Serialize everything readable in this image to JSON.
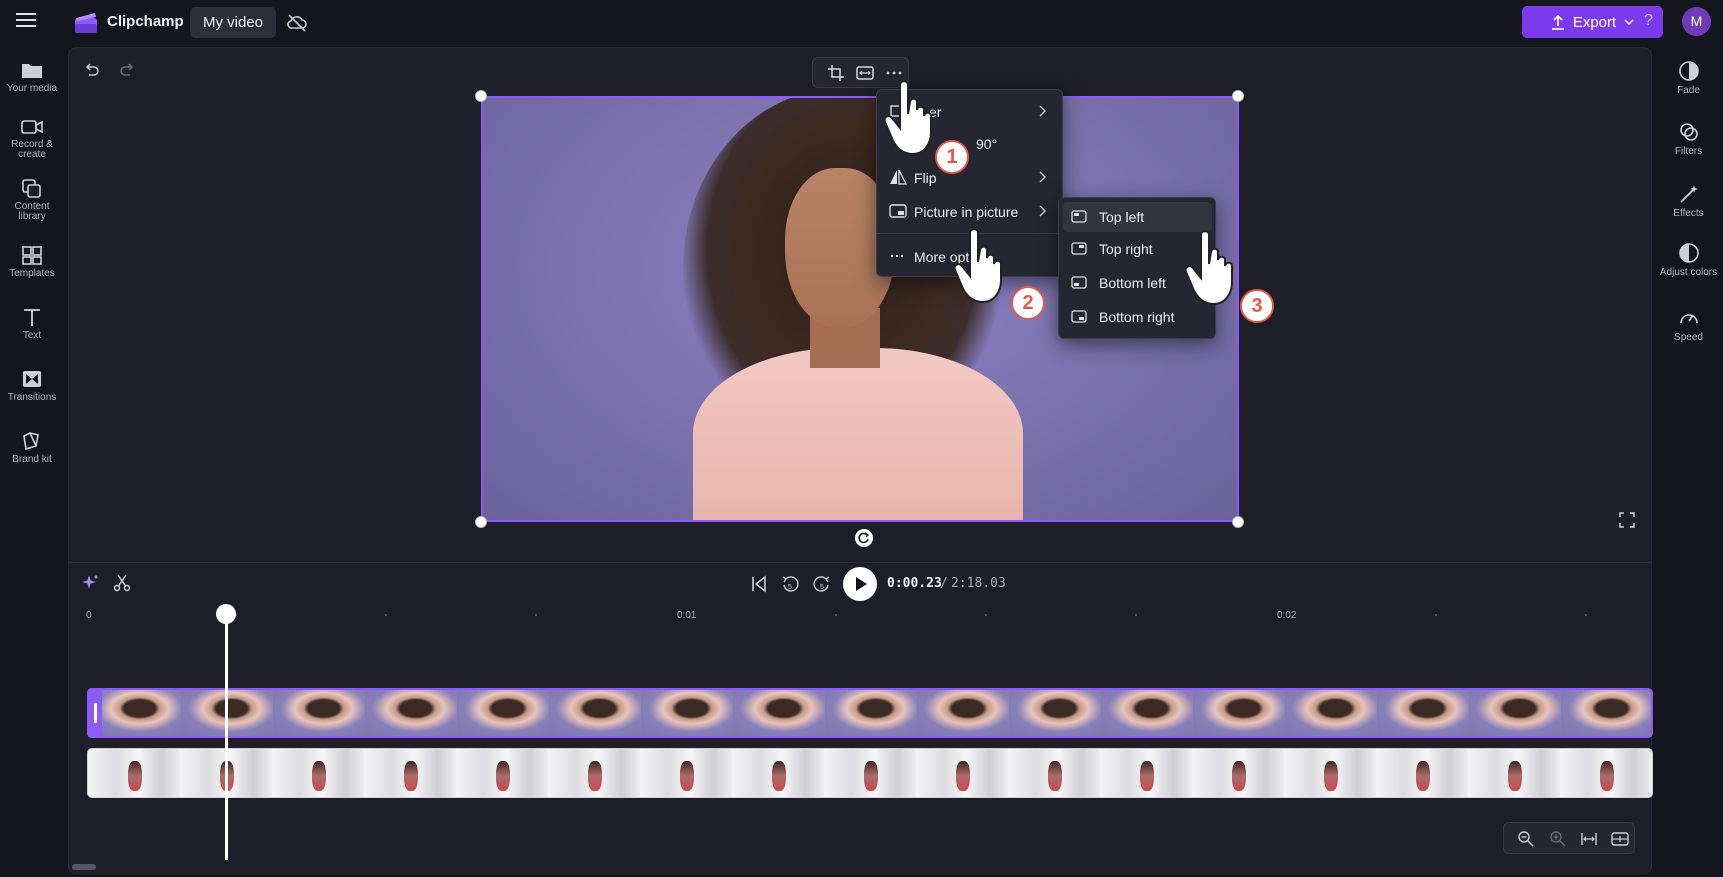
{
  "app": {
    "name": "Clipchamp",
    "project_name": "My video",
    "export_label": "Export",
    "help_label": "?",
    "avatar_initial": "M"
  },
  "left_sidebar": {
    "items": [
      {
        "label": "Your media",
        "icon": "folder-icon"
      },
      {
        "label": "Record & create",
        "icon": "camera-icon"
      },
      {
        "label": "Content library",
        "icon": "library-icon"
      },
      {
        "label": "Templates",
        "icon": "templates-icon"
      },
      {
        "label": "Text",
        "icon": "text-icon"
      },
      {
        "label": "Transitions",
        "icon": "transitions-icon"
      },
      {
        "label": "Brand kit",
        "icon": "brand-kit-icon"
      }
    ]
  },
  "right_sidebar": {
    "items": [
      {
        "label": "Fade",
        "icon": "fade-icon"
      },
      {
        "label": "Filters",
        "icon": "filters-icon"
      },
      {
        "label": "Effects",
        "icon": "effects-icon"
      },
      {
        "label": "Adjust colors",
        "icon": "adjust-colors-icon"
      },
      {
        "label": "Speed",
        "icon": "speed-icon"
      }
    ]
  },
  "context_menu": {
    "items": [
      {
        "label": "er",
        "icon": "layer-icon",
        "has_submenu": true
      },
      {
        "label": "90°",
        "icon": "rotate-icon",
        "has_submenu": false
      },
      {
        "label": "Flip",
        "icon": "flip-icon",
        "has_submenu": true
      },
      {
        "label": "Picture in picture",
        "icon": "pip-icon",
        "has_submenu": true
      },
      {
        "label": "More opt",
        "icon": "more-icon",
        "has_submenu": false
      }
    ]
  },
  "pip_submenu": {
    "items": [
      {
        "label": "Top left",
        "active": true
      },
      {
        "label": "Top right",
        "active": false
      },
      {
        "label": "Bottom left",
        "active": false
      },
      {
        "label": "Bottom right",
        "active": false
      }
    ]
  },
  "steps": [
    "1",
    "2",
    "3"
  ],
  "playback": {
    "current_time": "0:00.23",
    "separator": "/",
    "total_time": "2:18.03"
  },
  "timeline": {
    "ruler_labels": [
      "0",
      "0:01",
      "0:02"
    ]
  },
  "colors": {
    "accent": "#7c3aed",
    "selection": "#8b5cf6",
    "background": "#15151d",
    "panel": "#1e1e28",
    "step_badge": "#e05a4a"
  }
}
